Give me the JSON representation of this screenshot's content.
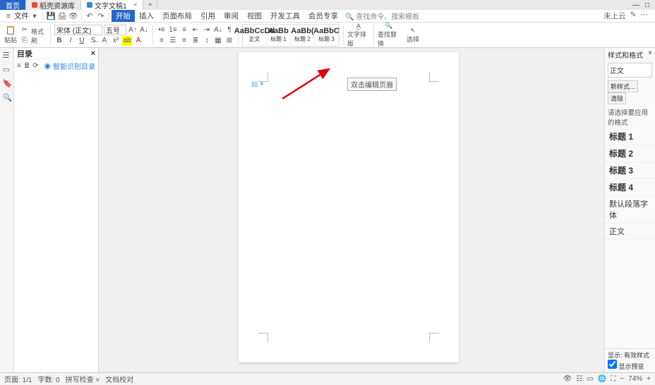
{
  "titlebar": {
    "home": "首页",
    "tab1": "稻壳资源库",
    "tab2": "文字文稿1",
    "plus": "+",
    "win_min": "—",
    "win_box": "□"
  },
  "menu": {
    "file": "文件",
    "tabs": [
      "开始",
      "插入",
      "页面布局",
      "引用",
      "审阅",
      "视图",
      "开发工具",
      "会员专享"
    ],
    "active_index": 0,
    "search_icon": "🔍",
    "search_placeholder": "查找命令、搜索模板",
    "right1": "未上云",
    "right2": "✎"
  },
  "ribbon": {
    "paste": "粘贴",
    "format_painter": "格式刷",
    "font_name": "宋体 (正文)",
    "font_size": "五号",
    "styles": [
      {
        "preview": "AaBbCcDd",
        "name": "正文"
      },
      {
        "preview": "AaBb",
        "name": "标题 1"
      },
      {
        "preview": "AaBb(",
        "name": "标题 2"
      },
      {
        "preview": "AaBbC",
        "name": "标题 3"
      }
    ],
    "text_tools": "文字排版",
    "find_replace": "查找替换",
    "select": "选择"
  },
  "outline": {
    "title": "目录",
    "smart": "智能识别目录"
  },
  "page": {
    "tooltip": "双击编辑页眉"
  },
  "styles_panel": {
    "header": "样式和格式",
    "current": "正文",
    "new_btn": "新样式...",
    "clear_btn": "清除",
    "prompt": "请选择要应用的格式",
    "list": [
      "标题 1",
      "标题 2",
      "标题 3",
      "标题 4",
      "默认段落字体",
      "正文"
    ],
    "show_label": "显示:",
    "show_value": "有效样式",
    "preview_check": "显示预览"
  },
  "status": {
    "page": "页面: 1/1",
    "words": "字数: 0",
    "spell": "拼写检查 ˅",
    "doc_check": "文档校对",
    "zoom": "74%",
    "zoom_minus": "−",
    "zoom_plus": "+"
  }
}
